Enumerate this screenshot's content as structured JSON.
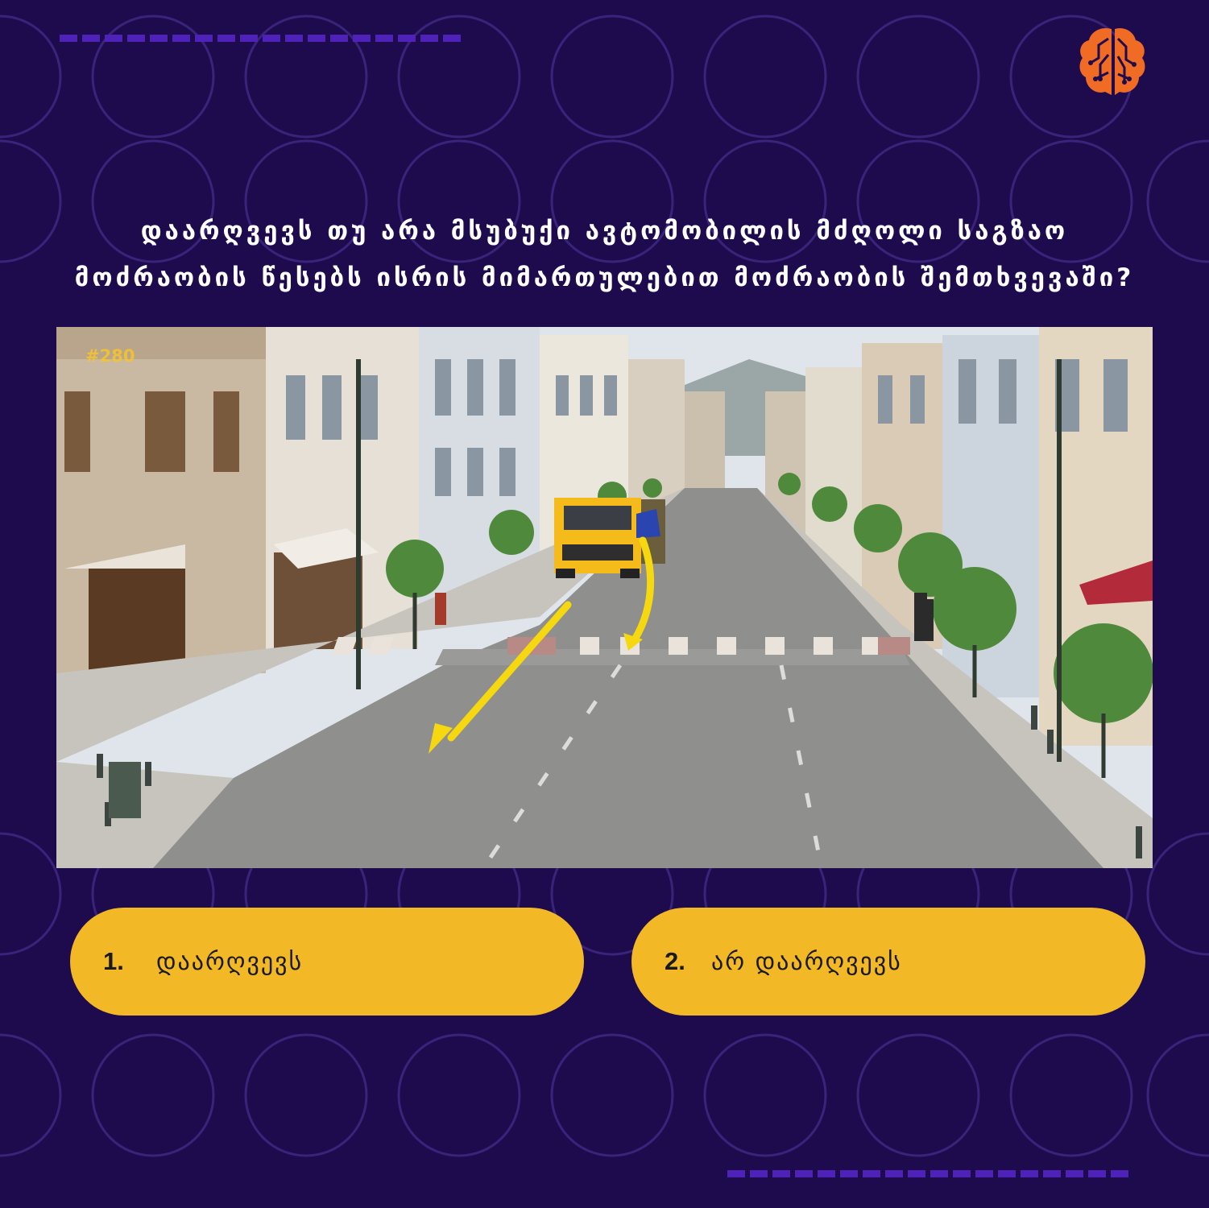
{
  "question": {
    "line1": "დაარღვევს თუ არა მსუბუქი ავტომობილის მძღოლი საგზაო",
    "line2": "მოძრაობის წესებს ისრის მიმართულებით მოძრაობის შემთხვევაში?"
  },
  "scene": {
    "tag": "#280"
  },
  "answers": [
    {
      "number": "1.",
      "text": "დაარღვევს"
    },
    {
      "number": "2.",
      "text": "არ დაარღვევს"
    }
  ],
  "colors": {
    "background": "#1e0b4e",
    "accent": "#f2b825",
    "logo": "#f06b24",
    "arrow": "#f5d80f"
  },
  "icons": {
    "logo": "brain-circuit-icon"
  }
}
